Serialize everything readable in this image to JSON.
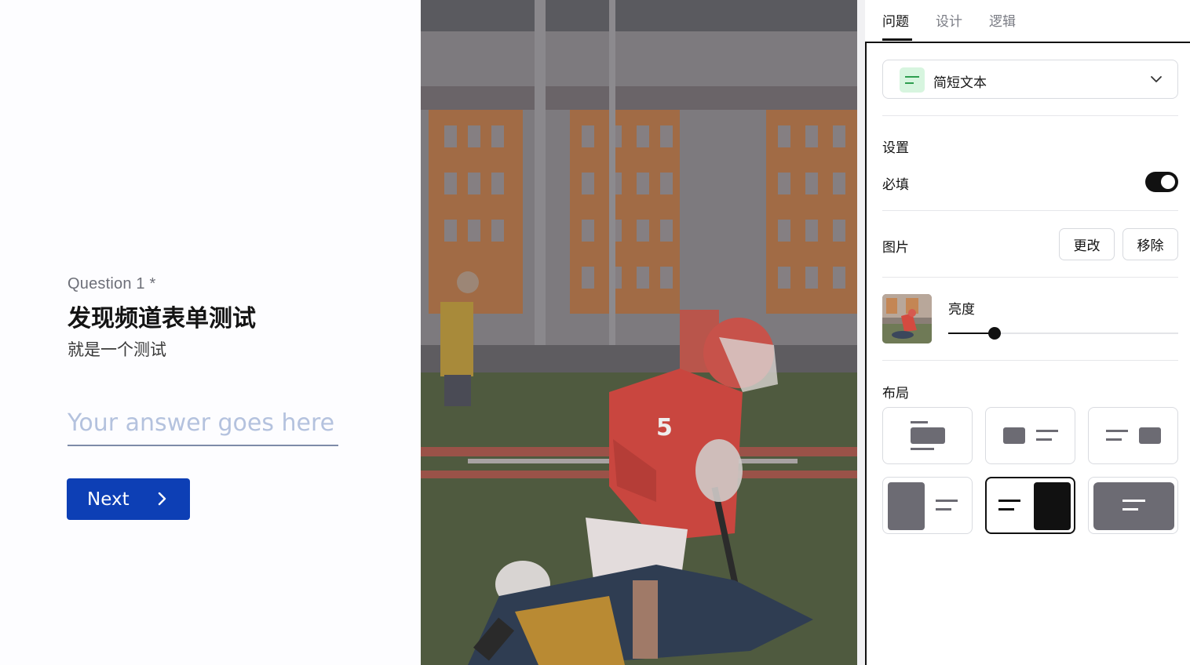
{
  "preview": {
    "question_number": "Question 1 *",
    "title": "发现频道表单测试",
    "description": "就是一个测试",
    "answer_placeholder": "Your answer goes here",
    "next_label": "Next",
    "image_jersey_number": "5"
  },
  "panel": {
    "tabs": [
      {
        "label": "问题",
        "active": true
      },
      {
        "label": "设计",
        "active": false
      },
      {
        "label": "逻辑",
        "active": false
      }
    ],
    "question_type": {
      "label": "简短文本",
      "icon": "short-text-icon",
      "icon_bg": "#d7f5df",
      "icon_color": "#2e9e4f"
    },
    "settings": {
      "title": "设置",
      "required_label": "必填",
      "required_on": true
    },
    "image": {
      "label": "图片",
      "change_label": "更改",
      "remove_label": "移除"
    },
    "brightness": {
      "label": "亮度",
      "value_fraction": 0.2
    },
    "layout": {
      "label": "布局",
      "options": [
        {
          "name": "image-top",
          "selected": false
        },
        {
          "name": "image-left-inline",
          "selected": false
        },
        {
          "name": "image-right-inline",
          "selected": false
        },
        {
          "name": "image-left-split",
          "selected": false
        },
        {
          "name": "image-right-split",
          "selected": true
        },
        {
          "name": "image-background",
          "selected": false
        }
      ]
    }
  },
  "colors": {
    "primary_button": "#0d3fb5",
    "accent_dark": "#111111"
  }
}
